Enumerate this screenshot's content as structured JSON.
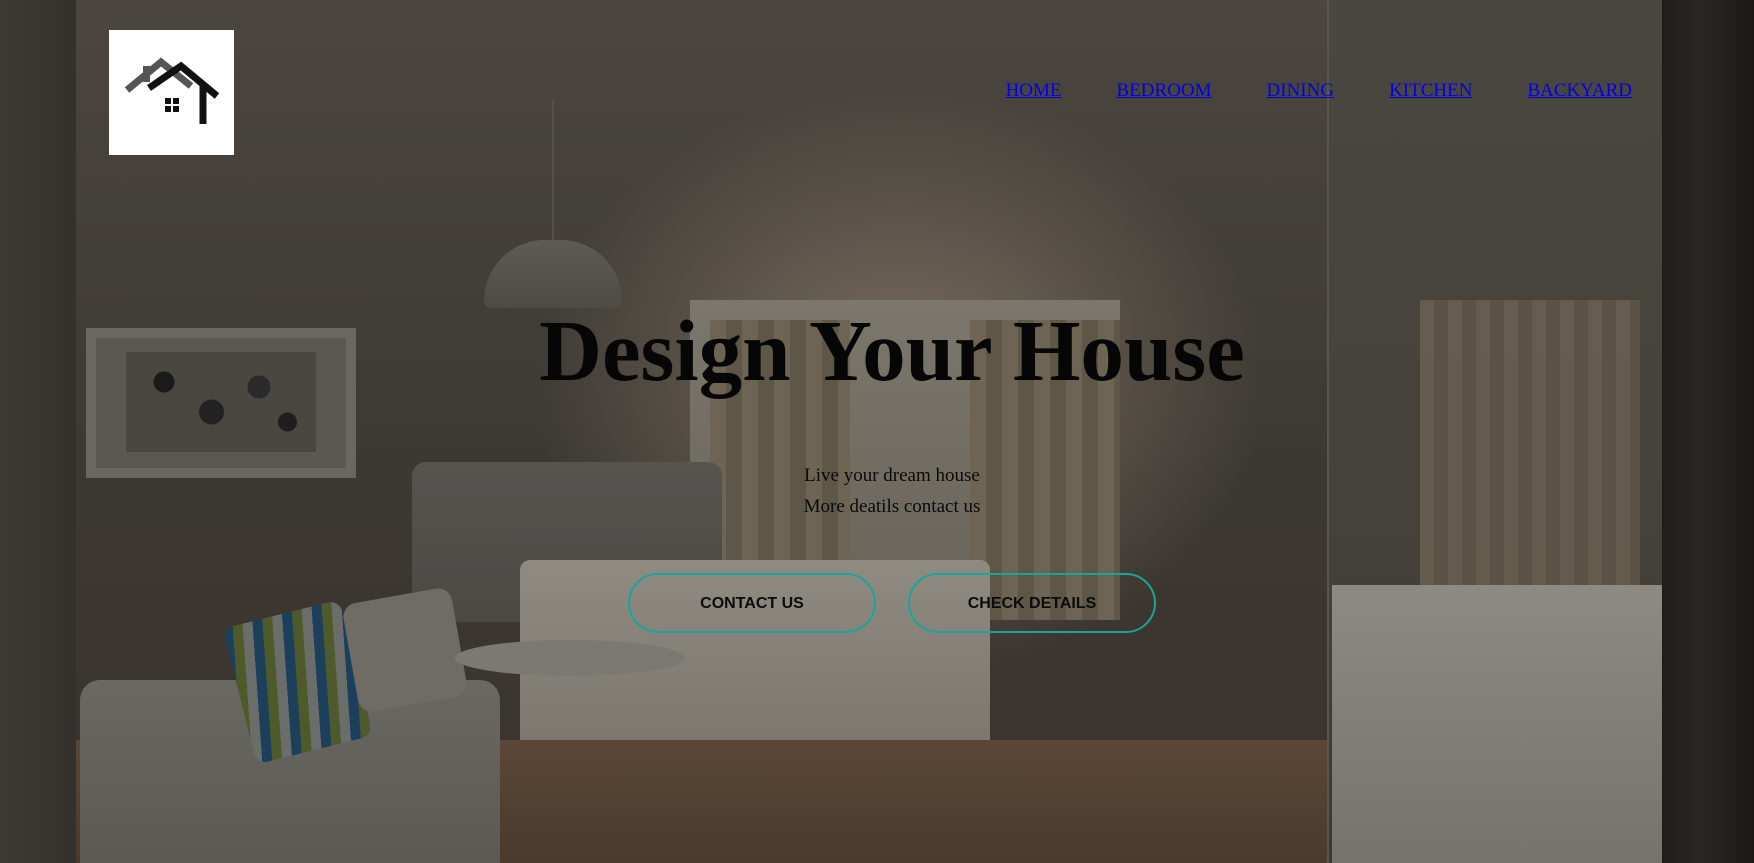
{
  "logo": {
    "icon": "house-roof-icon"
  },
  "nav": {
    "items": [
      "HOME",
      "BEDROOM",
      "DINING",
      "KITCHEN",
      "BACKYARD"
    ],
    "link_color": "#0000ee"
  },
  "hero": {
    "title": "Design Your House",
    "subtitle_line1": "Live your dream house",
    "subtitle_line2": "More deatils contact us",
    "background": "dimmed-bedroom-photo"
  },
  "buttons": {
    "contact_label": "CONTACT US",
    "details_label": "CHECK DETAILS",
    "border_color": "#1aa597"
  }
}
